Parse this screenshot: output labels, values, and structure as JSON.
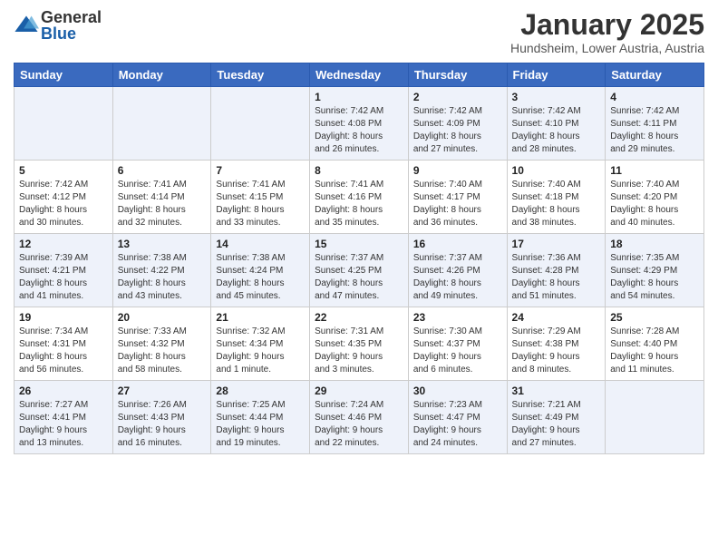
{
  "logo": {
    "general": "General",
    "blue": "Blue"
  },
  "title": "January 2025",
  "subtitle": "Hundsheim, Lower Austria, Austria",
  "days_of_week": [
    "Sunday",
    "Monday",
    "Tuesday",
    "Wednesday",
    "Thursday",
    "Friday",
    "Saturday"
  ],
  "weeks": [
    [
      {
        "day": "",
        "info": ""
      },
      {
        "day": "",
        "info": ""
      },
      {
        "day": "",
        "info": ""
      },
      {
        "day": "1",
        "info": "Sunrise: 7:42 AM\nSunset: 4:08 PM\nDaylight: 8 hours\nand 26 minutes."
      },
      {
        "day": "2",
        "info": "Sunrise: 7:42 AM\nSunset: 4:09 PM\nDaylight: 8 hours\nand 27 minutes."
      },
      {
        "day": "3",
        "info": "Sunrise: 7:42 AM\nSunset: 4:10 PM\nDaylight: 8 hours\nand 28 minutes."
      },
      {
        "day": "4",
        "info": "Sunrise: 7:42 AM\nSunset: 4:11 PM\nDaylight: 8 hours\nand 29 minutes."
      }
    ],
    [
      {
        "day": "5",
        "info": "Sunrise: 7:42 AM\nSunset: 4:12 PM\nDaylight: 8 hours\nand 30 minutes."
      },
      {
        "day": "6",
        "info": "Sunrise: 7:41 AM\nSunset: 4:14 PM\nDaylight: 8 hours\nand 32 minutes."
      },
      {
        "day": "7",
        "info": "Sunrise: 7:41 AM\nSunset: 4:15 PM\nDaylight: 8 hours\nand 33 minutes."
      },
      {
        "day": "8",
        "info": "Sunrise: 7:41 AM\nSunset: 4:16 PM\nDaylight: 8 hours\nand 35 minutes."
      },
      {
        "day": "9",
        "info": "Sunrise: 7:40 AM\nSunset: 4:17 PM\nDaylight: 8 hours\nand 36 minutes."
      },
      {
        "day": "10",
        "info": "Sunrise: 7:40 AM\nSunset: 4:18 PM\nDaylight: 8 hours\nand 38 minutes."
      },
      {
        "day": "11",
        "info": "Sunrise: 7:40 AM\nSunset: 4:20 PM\nDaylight: 8 hours\nand 40 minutes."
      }
    ],
    [
      {
        "day": "12",
        "info": "Sunrise: 7:39 AM\nSunset: 4:21 PM\nDaylight: 8 hours\nand 41 minutes."
      },
      {
        "day": "13",
        "info": "Sunrise: 7:38 AM\nSunset: 4:22 PM\nDaylight: 8 hours\nand 43 minutes."
      },
      {
        "day": "14",
        "info": "Sunrise: 7:38 AM\nSunset: 4:24 PM\nDaylight: 8 hours\nand 45 minutes."
      },
      {
        "day": "15",
        "info": "Sunrise: 7:37 AM\nSunset: 4:25 PM\nDaylight: 8 hours\nand 47 minutes."
      },
      {
        "day": "16",
        "info": "Sunrise: 7:37 AM\nSunset: 4:26 PM\nDaylight: 8 hours\nand 49 minutes."
      },
      {
        "day": "17",
        "info": "Sunrise: 7:36 AM\nSunset: 4:28 PM\nDaylight: 8 hours\nand 51 minutes."
      },
      {
        "day": "18",
        "info": "Sunrise: 7:35 AM\nSunset: 4:29 PM\nDaylight: 8 hours\nand 54 minutes."
      }
    ],
    [
      {
        "day": "19",
        "info": "Sunrise: 7:34 AM\nSunset: 4:31 PM\nDaylight: 8 hours\nand 56 minutes."
      },
      {
        "day": "20",
        "info": "Sunrise: 7:33 AM\nSunset: 4:32 PM\nDaylight: 8 hours\nand 58 minutes."
      },
      {
        "day": "21",
        "info": "Sunrise: 7:32 AM\nSunset: 4:34 PM\nDaylight: 9 hours\nand 1 minute."
      },
      {
        "day": "22",
        "info": "Sunrise: 7:31 AM\nSunset: 4:35 PM\nDaylight: 9 hours\nand 3 minutes."
      },
      {
        "day": "23",
        "info": "Sunrise: 7:30 AM\nSunset: 4:37 PM\nDaylight: 9 hours\nand 6 minutes."
      },
      {
        "day": "24",
        "info": "Sunrise: 7:29 AM\nSunset: 4:38 PM\nDaylight: 9 hours\nand 8 minutes."
      },
      {
        "day": "25",
        "info": "Sunrise: 7:28 AM\nSunset: 4:40 PM\nDaylight: 9 hours\nand 11 minutes."
      }
    ],
    [
      {
        "day": "26",
        "info": "Sunrise: 7:27 AM\nSunset: 4:41 PM\nDaylight: 9 hours\nand 13 minutes."
      },
      {
        "day": "27",
        "info": "Sunrise: 7:26 AM\nSunset: 4:43 PM\nDaylight: 9 hours\nand 16 minutes."
      },
      {
        "day": "28",
        "info": "Sunrise: 7:25 AM\nSunset: 4:44 PM\nDaylight: 9 hours\nand 19 minutes."
      },
      {
        "day": "29",
        "info": "Sunrise: 7:24 AM\nSunset: 4:46 PM\nDaylight: 9 hours\nand 22 minutes."
      },
      {
        "day": "30",
        "info": "Sunrise: 7:23 AM\nSunset: 4:47 PM\nDaylight: 9 hours\nand 24 minutes."
      },
      {
        "day": "31",
        "info": "Sunrise: 7:21 AM\nSunset: 4:49 PM\nDaylight: 9 hours\nand 27 minutes."
      },
      {
        "day": "",
        "info": ""
      }
    ]
  ]
}
